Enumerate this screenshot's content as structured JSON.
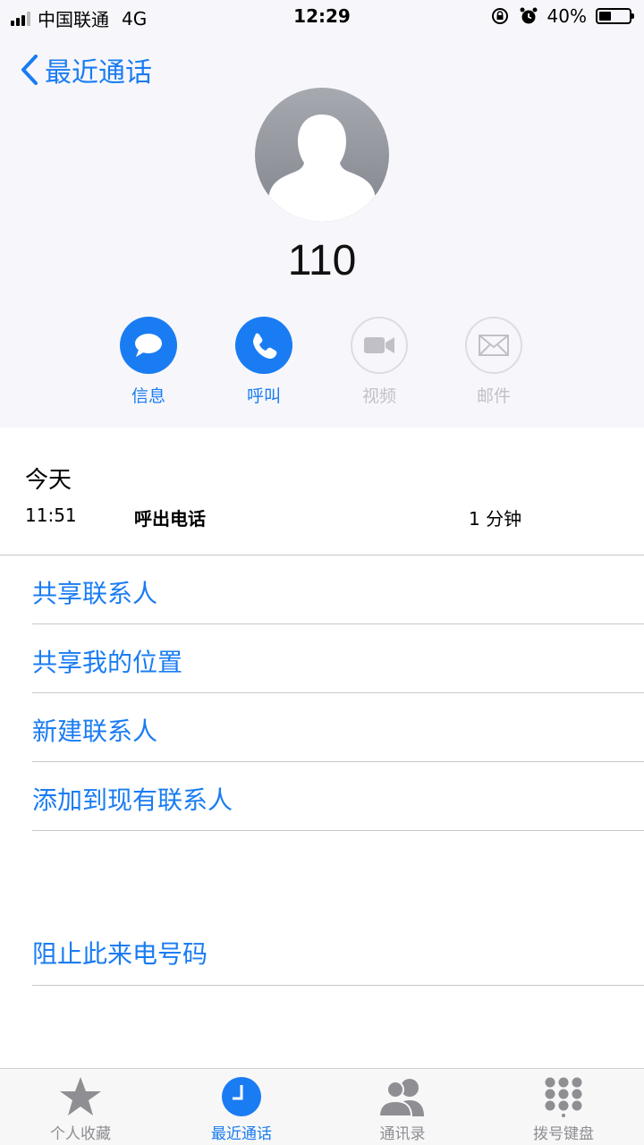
{
  "status_bar": {
    "carrier": "中国联通",
    "network": "4G",
    "time": "12:29",
    "battery": "40%",
    "battery_level": 0.4
  },
  "nav": {
    "back_label": "最近通话"
  },
  "contact": {
    "name": "110"
  },
  "actions": [
    {
      "label": "信息",
      "icon": "message-icon",
      "enabled": true
    },
    {
      "label": "呼叫",
      "icon": "phone-icon",
      "enabled": true
    },
    {
      "label": "视频",
      "icon": "video-icon",
      "enabled": false
    },
    {
      "label": "邮件",
      "icon": "mail-icon",
      "enabled": false
    }
  ],
  "history": {
    "day": "今天",
    "entries": [
      {
        "time": "11:51",
        "type": "呼出电话",
        "duration": "1 分钟"
      }
    ]
  },
  "options": {
    "share_contact": "共享联系人",
    "share_location": "共享我的位置",
    "new_contact": "新建联系人",
    "add_existing": "添加到现有联系人",
    "block": "阻止此来电号码"
  },
  "tabs": [
    {
      "label": "个人收藏",
      "icon": "star-icon",
      "active": false
    },
    {
      "label": "最近通话",
      "icon": "clock-icon",
      "active": true
    },
    {
      "label": "通讯录",
      "icon": "contacts-icon",
      "active": false
    },
    {
      "label": "拨号键盘",
      "icon": "keypad-icon",
      "active": false
    }
  ],
  "colors": {
    "accent": "#1a7cf2",
    "header_bg": "#f7f7fb",
    "disabled": "#c0c0c6",
    "tab_inactive": "#8e8e93"
  }
}
